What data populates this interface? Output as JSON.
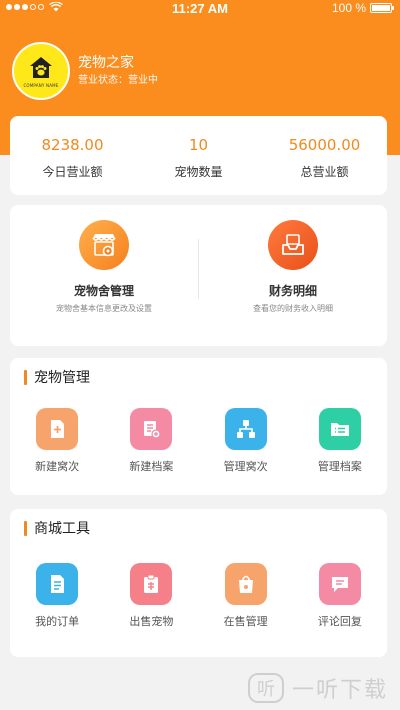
{
  "status_bar": {
    "time": "11:27 AM",
    "battery_text": "100 %"
  },
  "profile": {
    "logo_text": "COMPANY NAME",
    "name": "宠物之家",
    "status": "营业状态：营业中"
  },
  "stats": [
    {
      "value": "8238.00",
      "label": "今日营业额"
    },
    {
      "value": "10",
      "label": "宠物数量"
    },
    {
      "value": "56000.00",
      "label": "总营业额"
    }
  ],
  "management": [
    {
      "title": "宠物舍管理",
      "subtitle": "宠物舍基本信息更改及设置",
      "icon": "store-settings-icon"
    },
    {
      "title": "财务明细",
      "subtitle": "查看您的财务收入明细",
      "icon": "inbox-tray-icon"
    }
  ],
  "pet_management": {
    "title": "宠物管理",
    "items": [
      {
        "label": "新建窝次",
        "icon": "new-document-icon",
        "color": "#f7a36c"
      },
      {
        "label": "新建档案",
        "icon": "document-add-icon",
        "color": "#f58aa4"
      },
      {
        "label": "管理窝次",
        "icon": "hierarchy-icon",
        "color": "#3cb2ea"
      },
      {
        "label": "管理档案",
        "icon": "folder-list-icon",
        "color": "#2fcfa6"
      }
    ]
  },
  "mall_tools": {
    "title": "商城工具",
    "items": [
      {
        "label": "我的订单",
        "icon": "order-document-icon",
        "color": "#3cb2ea"
      },
      {
        "label": "出售宠物",
        "icon": "sale-tag-icon",
        "color": "#f5808a"
      },
      {
        "label": "在售管理",
        "icon": "shopping-bag-icon",
        "color": "#f7a36c"
      },
      {
        "label": "评论回复",
        "icon": "comment-icon",
        "color": "#f58aa4"
      }
    ]
  },
  "watermark": {
    "text": "一听下载",
    "icon_char": "听"
  },
  "colors": {
    "brand": "#fb8c1e",
    "accent": "#f08a1f"
  }
}
